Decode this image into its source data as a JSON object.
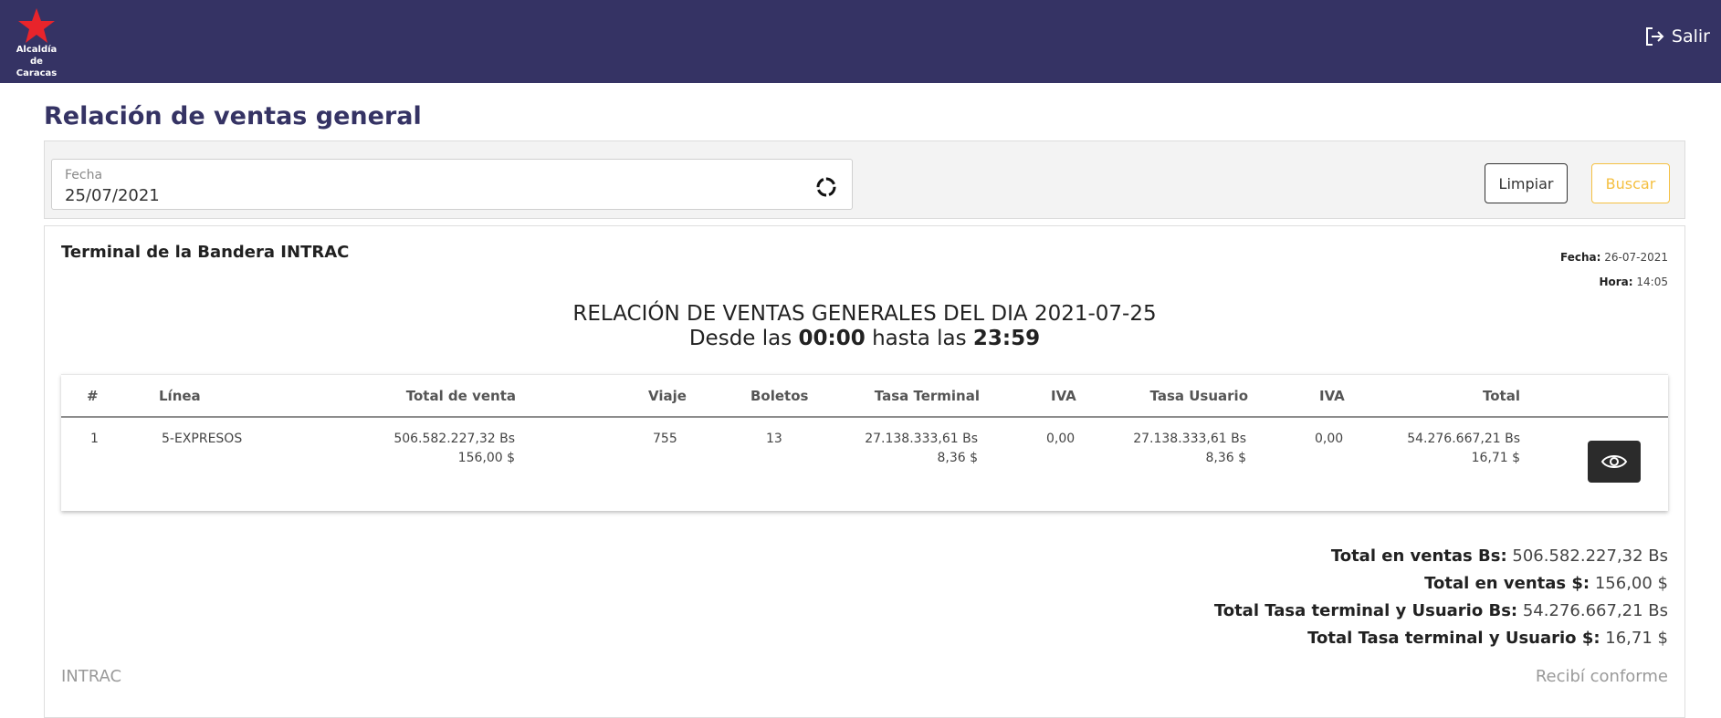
{
  "header": {
    "logo_line1": "Alcaldía",
    "logo_line2": "de Caracas",
    "logout_label": "Salir",
    "brand_color": "#353364",
    "star_color": "#e8242b"
  },
  "page": {
    "title": "Relación de ventas general"
  },
  "filter": {
    "date_label": "Fecha",
    "date_value": "25/07/2021",
    "clear_label": "Limpiar",
    "search_label": "Buscar",
    "search_color": "#f5c042"
  },
  "report": {
    "terminal": "Terminal de la Bandera INTRAC",
    "fecha_label": "Fecha:",
    "fecha_value": "26-07-2021",
    "hora_label": "Hora:",
    "hora_value": "14:05",
    "title": "RELACIÓN DE VENTAS GENERALES DEL DIA 2021-07-25",
    "sub_desde": "Desde las",
    "sub_start": "00:00",
    "sub_hasta": "hasta las",
    "sub_end": "23:59"
  },
  "table": {
    "columns": [
      "#",
      "Línea",
      "Total de venta",
      "Viaje",
      "Boletos",
      "Tasa Terminal",
      "IVA",
      "Tasa Usuario",
      "IVA",
      "Total"
    ],
    "rows": [
      {
        "num": "1",
        "linea": "5-EXPRESOS",
        "total_venta_bs": "506.582.227,32 Bs",
        "total_venta_usd": "156,00 $",
        "viaje": "755",
        "boletos": "13",
        "tasa_terminal_bs": "27.138.333,61 Bs",
        "tasa_terminal_usd": "8,36 $",
        "iva1": "0,00",
        "tasa_usuario_bs": "27.138.333,61 Bs",
        "tasa_usuario_usd": "8,36 $",
        "iva2": "0,00",
        "total_bs": "54.276.667,21 Bs",
        "total_usd": "16,71 $"
      }
    ]
  },
  "totals": {
    "ventas_bs_label": "Total en ventas Bs:",
    "ventas_bs_value": "506.582.227,32 Bs",
    "ventas_usd_label": "Total en ventas $:",
    "ventas_usd_value": "156,00 $",
    "tasa_bs_label": "Total Tasa terminal y Usuario Bs:",
    "tasa_bs_value": "54.276.667,21 Bs",
    "tasa_usd_label": "Total Tasa terminal y Usuario $:",
    "tasa_usd_value": "16,71 $"
  },
  "footer": {
    "left": "INTRAC",
    "right": "Recibí conforme"
  }
}
